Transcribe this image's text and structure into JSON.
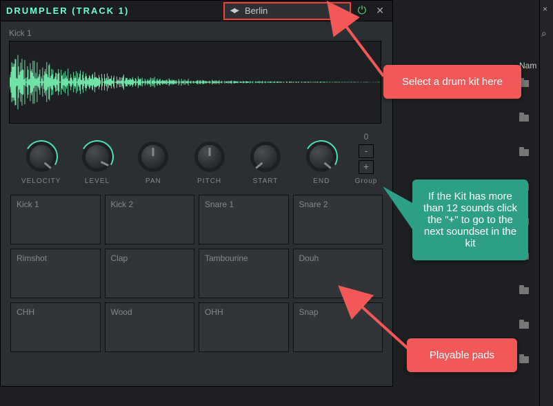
{
  "titlebar": {
    "plugin_name": "DRUMPLER",
    "track_suffix": "(TRACK 1)",
    "preset": "Berlin"
  },
  "sample": {
    "name": "Kick 1"
  },
  "knobs": [
    {
      "label": "VELOCITY",
      "active": true,
      "angle": 130
    },
    {
      "label": "LEVEL",
      "active": true,
      "angle": 115
    },
    {
      "label": "PAN",
      "active": false,
      "angle": 0
    },
    {
      "label": "PITCH",
      "active": false,
      "angle": 0
    },
    {
      "label": "START",
      "active": false,
      "angle": -130
    },
    {
      "label": "END",
      "active": true,
      "angle": 130
    }
  ],
  "group": {
    "current": "0",
    "label": "Group",
    "minus": "-",
    "plus": "+"
  },
  "pads": [
    "Kick 1",
    "Kick 2",
    "Snare 1",
    "Snare 2",
    "Rimshot",
    "Clap",
    "Tambourine",
    "Douh",
    "CHH",
    "Wood",
    "OHH",
    "Snap"
  ],
  "right_panel": {
    "close": "×",
    "search": "⌕",
    "col_label": "Nam"
  },
  "callouts": {
    "kit": "Select a drum kit here",
    "group": "If the Kit has more than 12 sounds click the \"+\"  to go to the next soundset in the kit",
    "pads": "Playable pads"
  }
}
